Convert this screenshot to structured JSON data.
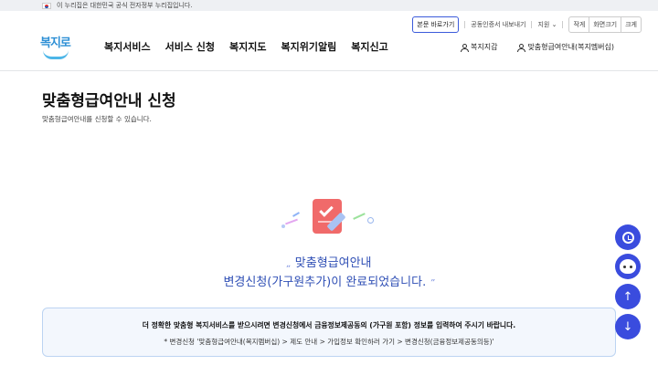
{
  "gov_banner": {
    "text": "이 누리집은 대한민국 공식 전자정부 누리집입니다."
  },
  "utility": {
    "skip_link": "본문 바로가기",
    "certificate": "공동인증서 내보내기",
    "support": "지원",
    "font_small": "작게",
    "font_size": "화면크기",
    "font_large": "크게"
  },
  "logo": {
    "text": "복지로"
  },
  "gnb": {
    "items": [
      "복지서비스",
      "서비스 신청",
      "복지지도",
      "복지위기알림",
      "복지신고"
    ]
  },
  "gnb_right": {
    "wallet": "복지지갑",
    "membership": "맞춤형급여안내(복지멤버십)"
  },
  "page": {
    "title": "맞춤형급여안내 신청",
    "description": "맞춤형급여안내를 신청할 수 있습니다."
  },
  "result": {
    "open_quote": "„",
    "line1": "맞춤형급여안내",
    "line2": "변경신청(가구원추가)이 완료되었습니다.",
    "close_quote": "”"
  },
  "notice": {
    "line1": "더 정확한 맞춤형 복지서비스를 받으시려면 변경신청에서 금융정보제공동의 (가구원 포함) 정보를 입력하여 주시기 바랍니다.",
    "line2": "* 변경신청 '맞춤형급여안내(복지멤버십) > 제도 안내 > 가입정보 확인하러 가기 > 변경신청(금융정보제공동의등)'"
  },
  "colors": {
    "primary": "#3a4cde",
    "message": "#2f4fb5",
    "notice_bg": "#f3f7fd",
    "notice_border": "#bcd4f2"
  }
}
